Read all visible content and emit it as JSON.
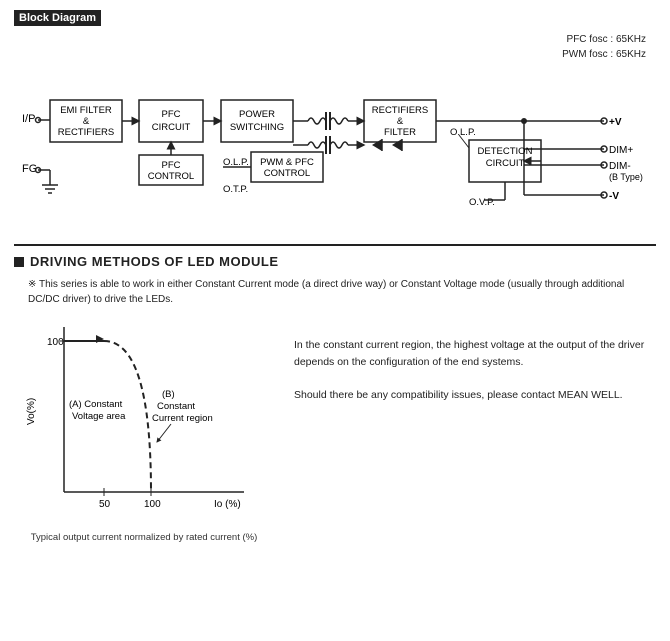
{
  "header": {
    "section_box": "■",
    "block_diagram_label": "Block Diagram",
    "pfc_fosc": "PFC fosc : 65KHz",
    "pwm_fosc": "PWM fosc : 65KHz"
  },
  "blocks": {
    "ip_label": "I/P",
    "fg_label": "FG",
    "emi_filter": "EMI FILTER\n&\nRECTIFIERS",
    "pfc_circuit": "PFC\nCIRCUIT",
    "power_switching": "POWER\nSWITCHING",
    "rectifiers_filter": "RECTIFIERS\n&\nFILTER",
    "pfc_control": "PFC\nCONTROL",
    "olp1": "O.L.P.",
    "pwm_pfc_control": "PWM & PFC\nCONTROL",
    "otp": "O.T.P.",
    "detection_circuit": "DETECTION\nCIRCUIT",
    "olp2": "O.L.P.",
    "ovp": "O.V.P.",
    "vplus": "+V",
    "vminus": "-V",
    "dim_plus": "DIM+",
    "dim_minus": "DIM-",
    "b_type": "(B Type)"
  },
  "driving": {
    "title": "DRIVING METHODS OF LED MODULE",
    "note": "This series is able to work in either Constant Current mode (a direct drive way) or\nConstant Voltage mode (usually through additional DC/DC driver) to drive the LEDs.",
    "chart": {
      "y_label": "Vo(%)",
      "x_label": "Io (%)",
      "y_value": "100",
      "x_50": "50",
      "x_100": "100",
      "area_a_label": "(A) Constant\nVoltage area",
      "area_b_label": "(B)\nConstant\nCurrent region"
    },
    "caption": "Typical output current normalized by rated current (%)",
    "text_line1": "In the constant current region, the highest voltage at the output of the driver",
    "text_line2": "depends on the configuration of the end systems.",
    "text_line3": "Should there be any compatibility issues, please contact MEAN WELL."
  }
}
